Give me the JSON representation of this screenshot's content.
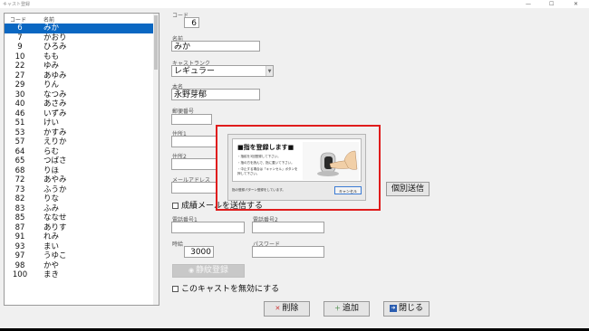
{
  "window": {
    "title": "キャスト登録",
    "controls": [
      "—",
      "☐",
      "✕"
    ]
  },
  "list": {
    "col_code": "コード",
    "col_name": "名前",
    "rows": [
      {
        "no": "6",
        "name": "みか",
        "selected": true
      },
      {
        "no": "7",
        "name": "かおり"
      },
      {
        "no": "9",
        "name": "ひろみ"
      },
      {
        "no": "10",
        "name": "もも"
      },
      {
        "no": "22",
        "name": "ゆみ"
      },
      {
        "no": "27",
        "name": "あゆみ"
      },
      {
        "no": "29",
        "name": "りん"
      },
      {
        "no": "30",
        "name": "なつみ"
      },
      {
        "no": "40",
        "name": "あさみ"
      },
      {
        "no": "46",
        "name": "いずみ"
      },
      {
        "no": "51",
        "name": "けい"
      },
      {
        "no": "53",
        "name": "かすみ"
      },
      {
        "no": "57",
        "name": "えりか"
      },
      {
        "no": "64",
        "name": "らむ"
      },
      {
        "no": "65",
        "name": "つばさ"
      },
      {
        "no": "68",
        "name": "りほ"
      },
      {
        "no": "72",
        "name": "あやみ"
      },
      {
        "no": "73",
        "name": "ふうか"
      },
      {
        "no": "82",
        "name": "りな"
      },
      {
        "no": "83",
        "name": "ふみ"
      },
      {
        "no": "85",
        "name": "ななせ"
      },
      {
        "no": "87",
        "name": "ありす"
      },
      {
        "no": "91",
        "name": "れみ"
      },
      {
        "no": "93",
        "name": "まい"
      },
      {
        "no": "97",
        "name": "うゆこ"
      },
      {
        "no": "98",
        "name": "かや"
      },
      {
        "no": "100",
        "name": "まき"
      }
    ]
  },
  "form": {
    "code_label": "コード",
    "code_value": "6",
    "name_label": "名前",
    "name_value": "みか",
    "rank_label": "キャストランク",
    "rank_value": "レギュラー",
    "real_name_label": "本名",
    "real_name_value": "永野芽郁",
    "postal_label": "郵便番号",
    "postal_value": "",
    "address1_label": "住所1",
    "address2_label": "住所2",
    "email_label": "メールアドレス",
    "send_individual_label": "個別送信",
    "send_result_mail_label": "成績メールを送信する",
    "phone1_label": "電話番号1",
    "phone2_label": "電話番号2",
    "hourly_label": "時給",
    "hourly_value": "3000",
    "password_label": "パスワード",
    "vein_register_label": "静紋登録",
    "disable_cast_label": "このキャストを無効にする"
  },
  "buttons": {
    "delete_label": "削除",
    "add_label": "追加",
    "close_label": "閉じる"
  },
  "dialog": {
    "title": "■指を登録します■",
    "line1": "・指紋を3回登録して下さい。",
    "line2": "・指の方を読んで、指に置いて下さい。",
    "line3": "・中止する場合は「キャンセル」ボタンを",
    "line4": "  押して下さい。",
    "status": "指の登録パターン登録をしています。",
    "cancel_label": "キャンセル"
  },
  "colors": {
    "selection": "#0a67c2",
    "highlight_border": "#e01c1c"
  }
}
